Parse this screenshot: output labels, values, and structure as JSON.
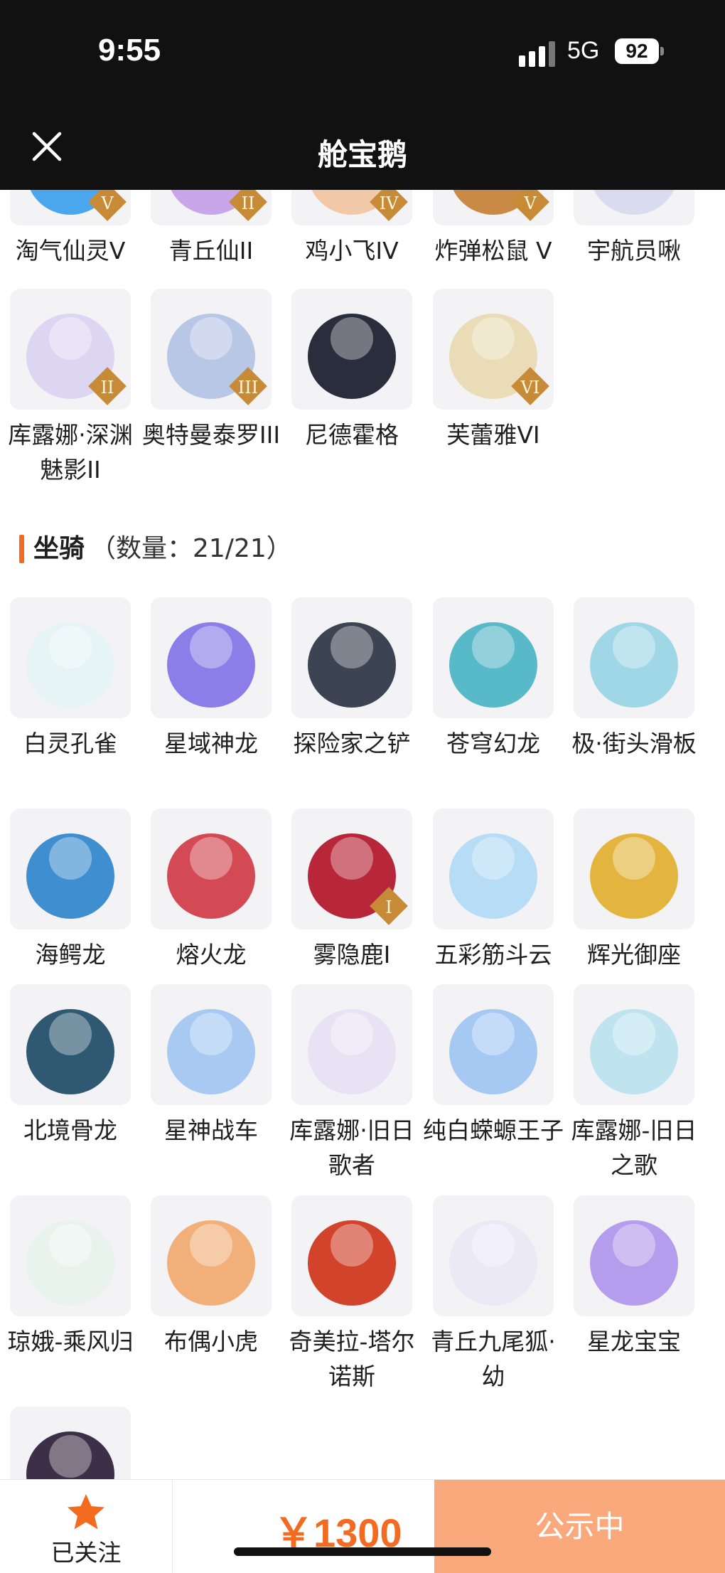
{
  "status_bar": {
    "time": "9:55",
    "network": "5G",
    "battery": "92"
  },
  "nav": {
    "title": "舱宝鹅",
    "close_icon": "close-icon"
  },
  "top_items": [
    {
      "name": "淘气仙灵V",
      "badge": "V",
      "color": "#4aa7ee"
    },
    {
      "name": "青丘仙II",
      "badge": "II",
      "color": "#c9a6ea"
    },
    {
      "name": "鸡小飞IV",
      "badge": "IV",
      "color": "#f1c9a9"
    },
    {
      "name": "炸弹松鼠 V",
      "badge": "V",
      "color": "#c98a46"
    },
    {
      "name": "宇航员啾",
      "badge": "",
      "color": "#d9dbef"
    },
    {
      "name": "库露娜·深渊魅影II",
      "badge": "II",
      "color": "#ddd6f2"
    },
    {
      "name": "奥特曼泰罗III",
      "badge": "III",
      "color": "#b8c7e6"
    },
    {
      "name": "尼德霍格",
      "badge": "",
      "color": "#2a2e3c"
    },
    {
      "name": "芙蕾雅VI",
      "badge": "VI",
      "color": "#eadcb7"
    }
  ],
  "mount_section": {
    "title": "坐骑",
    "count": "（数量：21/21）"
  },
  "mounts": [
    {
      "name": "白灵孔雀",
      "badge": "",
      "color": "#e6f4f5"
    },
    {
      "name": "星域神龙",
      "badge": "",
      "color": "#8c7de8"
    },
    {
      "name": "探险家之铲",
      "badge": "",
      "color": "#3c4352"
    },
    {
      "name": "苍穹幻龙",
      "badge": "",
      "color": "#58b9c9"
    },
    {
      "name": "极·街头滑板",
      "badge": "",
      "color": "#9fd7e6"
    },
    {
      "name": "海鳄龙",
      "badge": "",
      "color": "#3f8fd0"
    },
    {
      "name": "熔火龙",
      "badge": "",
      "color": "#d34a54"
    },
    {
      "name": "雾隐鹿I",
      "badge": "I",
      "color": "#b8263a"
    },
    {
      "name": "五彩筋斗云",
      "badge": "",
      "color": "#b6dcf6"
    },
    {
      "name": "辉光御座",
      "badge": "",
      "color": "#e3b53f"
    },
    {
      "name": "北境骨龙",
      "badge": "",
      "color": "#2f5872"
    },
    {
      "name": "星神战车",
      "badge": "",
      "color": "#a7c9f2"
    },
    {
      "name": "库露娜·旧日歌者",
      "badge": "",
      "color": "#e8e2f4"
    },
    {
      "name": "纯白蝾螈王子",
      "badge": "",
      "color": "#a6c9f4"
    },
    {
      "name": "库露娜-旧日之歌",
      "badge": "",
      "color": "#bfe3ef"
    },
    {
      "name": "琼娥-乘风归",
      "badge": "",
      "color": "#e9f3ee"
    },
    {
      "name": "布偶小虎",
      "badge": "",
      "color": "#f1b07a"
    },
    {
      "name": "奇美拉-塔尔诺斯",
      "badge": "",
      "color": "#d2432c"
    },
    {
      "name": "青丘九尾狐·幼",
      "badge": "",
      "color": "#ece9f7"
    },
    {
      "name": "星龙宝宝",
      "badge": "",
      "color": "#b59cec"
    },
    {
      "name": "",
      "badge": "",
      "color": "#3d2f47"
    }
  ],
  "bottom_bar": {
    "follow_label": "已关注",
    "follow_icon": "star-icon",
    "price": "￥1300",
    "status_button": "公示中"
  },
  "colors": {
    "accent": "#f26b21",
    "status_button": "#f9a97b",
    "nav_bg": "#111111"
  }
}
